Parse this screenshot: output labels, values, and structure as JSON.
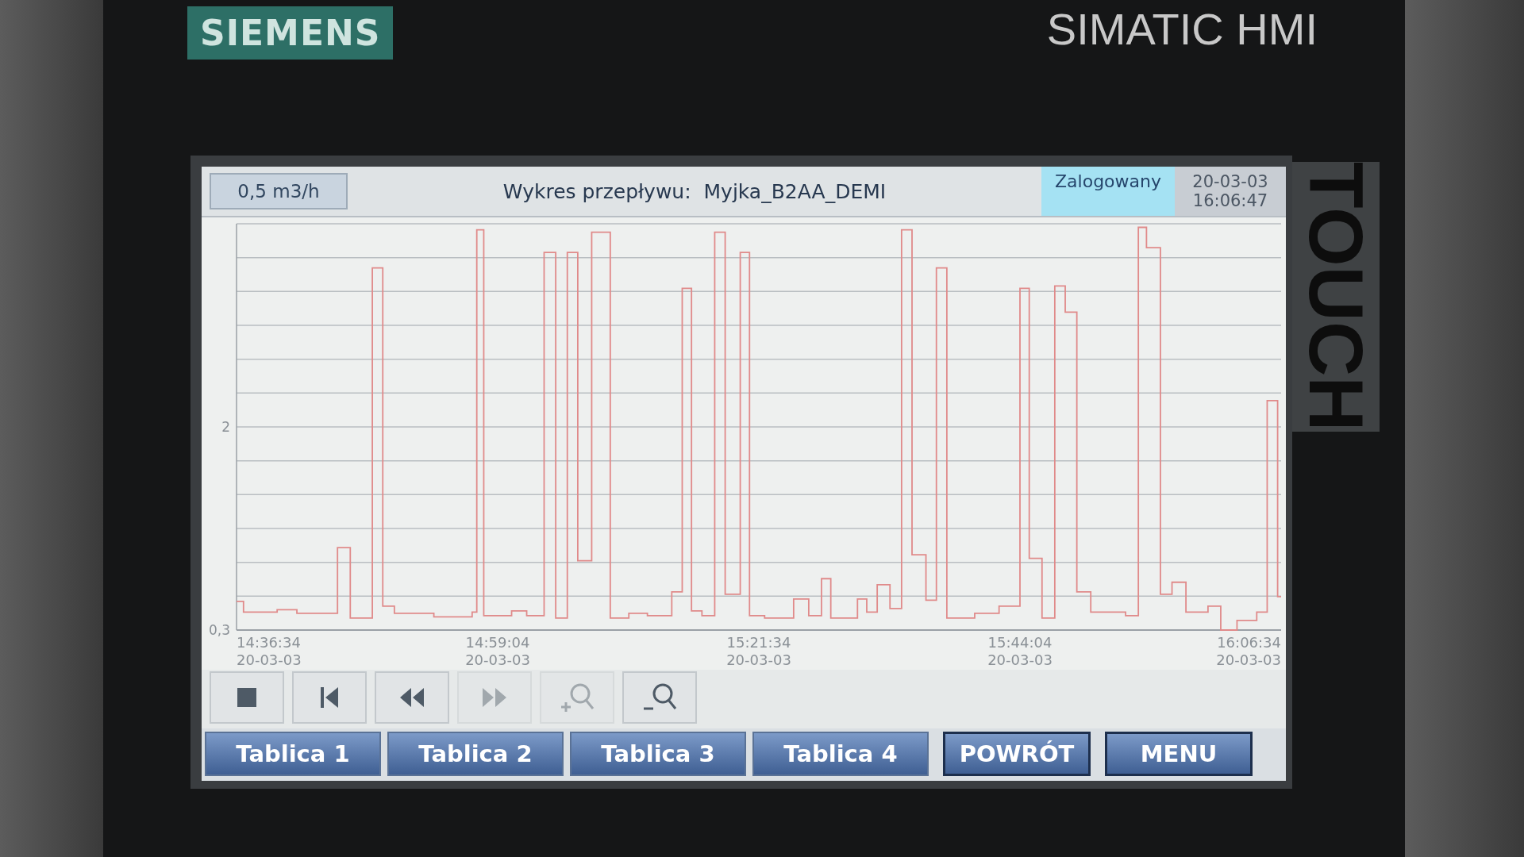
{
  "bezel": {
    "brand": "SIEMENS",
    "model": "SIMATIC HMI",
    "side_label": "TOUCH"
  },
  "header": {
    "reading": "0,5 m3/h",
    "title": "Wykres przepływu:  Myjka_B2AA_DEMI",
    "user_status": "Zalogowany",
    "date": "20-03-03",
    "time": "16:06:47"
  },
  "trend": {
    "y_labels": [
      "2",
      "0,3"
    ],
    "x_labels": [
      {
        "time": "14:36:34",
        "date": "20-03-03"
      },
      {
        "time": "14:59:04",
        "date": "20-03-03"
      },
      {
        "time": "15:21:34",
        "date": "20-03-03"
      },
      {
        "time": "15:44:04",
        "date": "20-03-03"
      },
      {
        "time": "16:06:34",
        "date": "20-03-03"
      }
    ]
  },
  "controls": [
    {
      "kind": "stop",
      "disabled": false
    },
    {
      "kind": "first",
      "disabled": false
    },
    {
      "kind": "rewind",
      "disabled": false
    },
    {
      "kind": "forward",
      "disabled": true
    },
    {
      "kind": "zoom_in",
      "disabled": true
    },
    {
      "kind": "zoom_out",
      "disabled": false
    }
  ],
  "nav": [
    {
      "label": "Tablica 1",
      "kind": "tab"
    },
    {
      "label": "Tablica 2",
      "kind": "tab"
    },
    {
      "label": "Tablica 3",
      "kind": "tab"
    },
    {
      "label": "Tablica 4",
      "kind": "tab"
    },
    {
      "label": "POWRÓT",
      "kind": "action"
    },
    {
      "label": "MENU",
      "kind": "action"
    }
  ]
}
